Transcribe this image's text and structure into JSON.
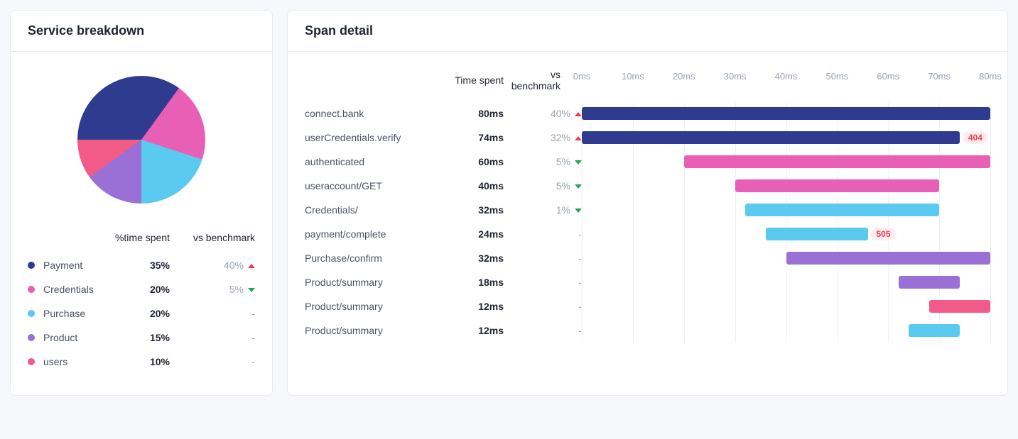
{
  "colors": {
    "payment": "#2f3b8f",
    "credentials": "#e85fb6",
    "purchase": "#5bcaf0",
    "product": "#9a70d6",
    "users": "#f25a87",
    "up": "#ef3b52",
    "down": "#1fa65a",
    "muted": "#9aa3b2"
  },
  "breakdown": {
    "title": "Service breakdown",
    "columns": {
      "time": "%time spent",
      "bench": "vs benchmark"
    },
    "rows": [
      {
        "name": "Payment",
        "colorKey": "payment",
        "time": "35%",
        "bench": "40%",
        "dir": "up"
      },
      {
        "name": "Credentials",
        "colorKey": "credentials",
        "time": "20%",
        "bench": "5%",
        "dir": "down"
      },
      {
        "name": "Purchase",
        "colorKey": "purchase",
        "time": "20%",
        "bench": "-",
        "dir": "none"
      },
      {
        "name": "Product",
        "colorKey": "product",
        "time": "15%",
        "bench": "-",
        "dir": "none"
      },
      {
        "name": "users",
        "colorKey": "users",
        "time": "10%",
        "bench": "-",
        "dir": "none"
      }
    ]
  },
  "spanDetail": {
    "title": "Span detail",
    "columns": {
      "time": "Time spent",
      "bench": "vs benchmark"
    },
    "axis": {
      "min": 0,
      "max": 80,
      "unit": "ms",
      "ticks": [
        0,
        10,
        20,
        30,
        40,
        50,
        60,
        70,
        80
      ]
    },
    "rows": [
      {
        "name": "connect.bank",
        "time": "80ms",
        "bench": "40%",
        "dir": "up",
        "start": 0,
        "end": 80,
        "colorKey": "payment"
      },
      {
        "name": "userCredentials.verify",
        "time": "74ms",
        "bench": "32%",
        "dir": "up",
        "start": 0,
        "end": 74,
        "colorKey": "payment",
        "badge": "404"
      },
      {
        "name": "authenticated",
        "time": "60ms",
        "bench": "5%",
        "dir": "down",
        "start": 20,
        "end": 80,
        "colorKey": "credentials"
      },
      {
        "name": "useraccount/GET",
        "time": "40ms",
        "bench": "5%",
        "dir": "down",
        "start": 30,
        "end": 70,
        "colorKey": "credentials"
      },
      {
        "name": "Credentials/",
        "time": "32ms",
        "bench": "1%",
        "dir": "down",
        "start": 32,
        "end": 70,
        "colorKey": "purchase"
      },
      {
        "name": "payment/complete",
        "time": "24ms",
        "bench": "-",
        "dir": "none",
        "start": 36,
        "end": 56,
        "colorKey": "purchase",
        "badge": "505"
      },
      {
        "name": "Purchase/confirm",
        "time": "32ms",
        "bench": "-",
        "dir": "none",
        "start": 40,
        "end": 80,
        "colorKey": "product"
      },
      {
        "name": "Product/summary",
        "time": "18ms",
        "bench": "-",
        "dir": "none",
        "start": 62,
        "end": 74,
        "colorKey": "product"
      },
      {
        "name": "Product/summary",
        "time": "12ms",
        "bench": "-",
        "dir": "none",
        "start": 68,
        "end": 80,
        "colorKey": "users"
      },
      {
        "name": "Product/summary",
        "time": "12ms",
        "bench": "-",
        "dir": "none",
        "start": 64,
        "end": 74,
        "colorKey": "purchase"
      }
    ]
  },
  "chart_data": [
    {
      "type": "pie",
      "title": "Service breakdown — %time spent",
      "series": [
        {
          "name": "Payment",
          "value": 35
        },
        {
          "name": "Credentials",
          "value": 20
        },
        {
          "name": "Purchase",
          "value": 20
        },
        {
          "name": "Product",
          "value": 15
        },
        {
          "name": "users",
          "value": 10
        }
      ]
    },
    {
      "type": "bar",
      "title": "Span detail",
      "xlabel": "ms",
      "xlim": [
        0,
        80
      ],
      "categories": [
        "connect.bank",
        "userCredentials.verify",
        "authenticated",
        "useraccount/GET",
        "Credentials/",
        "payment/complete",
        "Purchase/confirm",
        "Product/summary",
        "Product/summary",
        "Product/summary"
      ],
      "series": [
        {
          "name": "start",
          "values": [
            0,
            0,
            20,
            30,
            32,
            36,
            40,
            62,
            68,
            64
          ]
        },
        {
          "name": "end",
          "values": [
            80,
            74,
            80,
            70,
            70,
            56,
            80,
            74,
            80,
            74
          ]
        },
        {
          "name": "duration_ms",
          "values": [
            80,
            74,
            60,
            40,
            32,
            24,
            32,
            18,
            12,
            12
          ]
        }
      ],
      "annotations": [
        {
          "row": 1,
          "text": "404"
        },
        {
          "row": 5,
          "text": "505"
        }
      ]
    }
  ]
}
